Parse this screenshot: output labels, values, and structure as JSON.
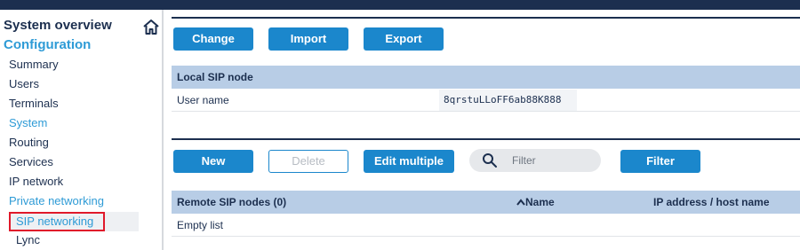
{
  "sidebar": {
    "system_overview": "System overview",
    "configuration": "Configuration",
    "items": [
      {
        "label": "Summary"
      },
      {
        "label": "Users"
      },
      {
        "label": "Terminals"
      },
      {
        "label": "System"
      },
      {
        "label": "Routing"
      },
      {
        "label": "Services"
      },
      {
        "label": "IP network"
      },
      {
        "label": "Private networking"
      }
    ],
    "sub_items": [
      {
        "label": "SIP networking"
      },
      {
        "label": "Lync"
      }
    ]
  },
  "toolbar_top": {
    "change": "Change",
    "import": "Import",
    "export": "Export"
  },
  "local_sip": {
    "header": "Local SIP node",
    "user_name_label": "User name",
    "user_name_value": "8qrstuLLoFF6ab88K888"
  },
  "toolbar_remote": {
    "new": "New",
    "delete": "Delete",
    "edit_multiple": "Edit multiple",
    "filter_placeholder": "Filter",
    "filter_button": "Filter"
  },
  "remote_sip": {
    "header": "Remote SIP nodes (0)",
    "columns": [
      "Name",
      "IP address / host name"
    ],
    "empty": "Empty list"
  },
  "colors": {
    "navy": "#1c2f4f",
    "accent_blue": "#2e9bd6",
    "button_blue": "#1b87cc",
    "section_header": "#b8cde6",
    "highlight_border": "#e0192a"
  },
  "icons": {
    "home": "home-icon",
    "search": "search-icon",
    "sort": "sort-ascending-icon"
  }
}
